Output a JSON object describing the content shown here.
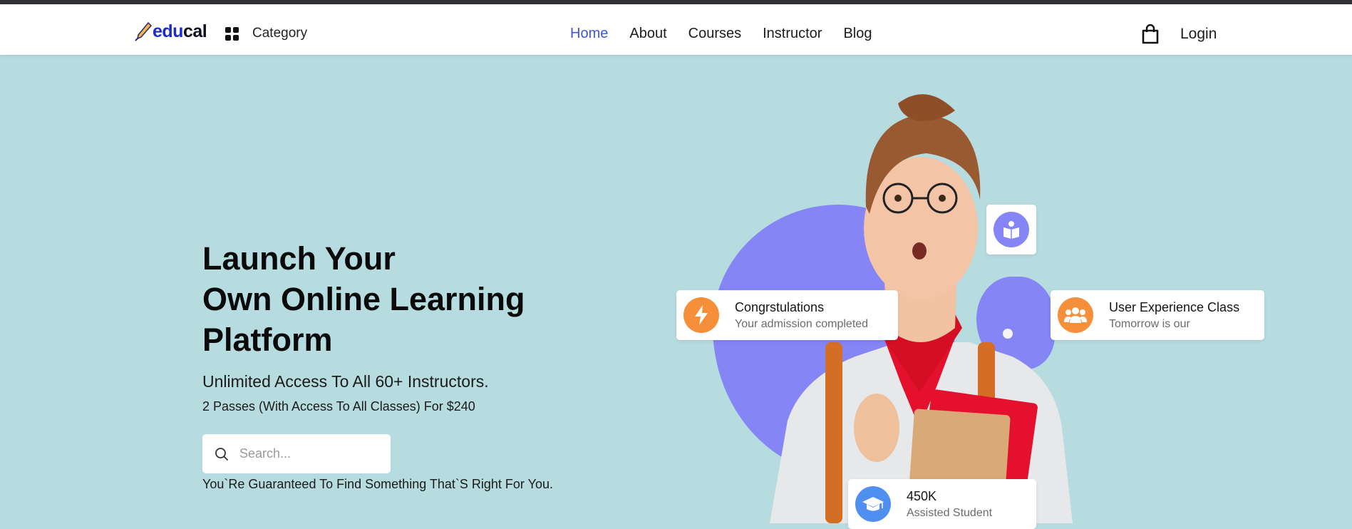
{
  "header": {
    "logo": {
      "part1": "edu",
      "part2": "cal"
    },
    "category_label": "Category",
    "nav": [
      {
        "label": "Home",
        "active": true
      },
      {
        "label": "About",
        "active": false
      },
      {
        "label": "Courses",
        "active": false
      },
      {
        "label": "Instructor",
        "active": false
      },
      {
        "label": "Blog",
        "active": false
      }
    ],
    "cart_icon": "shopping-bag-icon",
    "login_label": "Login"
  },
  "hero": {
    "title_lines": [
      "Launch Your",
      "Own Online Learning",
      "Platform"
    ],
    "subtitle": "Unlimited Access To All 60+ Instructors.",
    "subtitle2": "2 Passes (With Access To All Classes) For $240",
    "search": {
      "placeholder": "Search...",
      "value": ""
    },
    "guarantee": "You`Re Guaranteed To Find Something That`S Right For You."
  },
  "cards": {
    "congrats": {
      "title": "Congrstulations",
      "subtitle": "Your admission completed",
      "icon": "lightning-icon"
    },
    "ux": {
      "title": "User Experience Class",
      "subtitle": "Tomorrow is our",
      "icon": "users-icon"
    },
    "students": {
      "title": "450K",
      "subtitle": "Assisted Student",
      "icon": "graduation-cap-icon"
    },
    "book": {
      "icon": "book-reader-icon"
    }
  },
  "colors": {
    "background": "#b7dce0",
    "accent": "#3f56e0",
    "blob": "#8585f5",
    "orange": "#f58f3a",
    "blue_icon": "#4f8ff0"
  }
}
